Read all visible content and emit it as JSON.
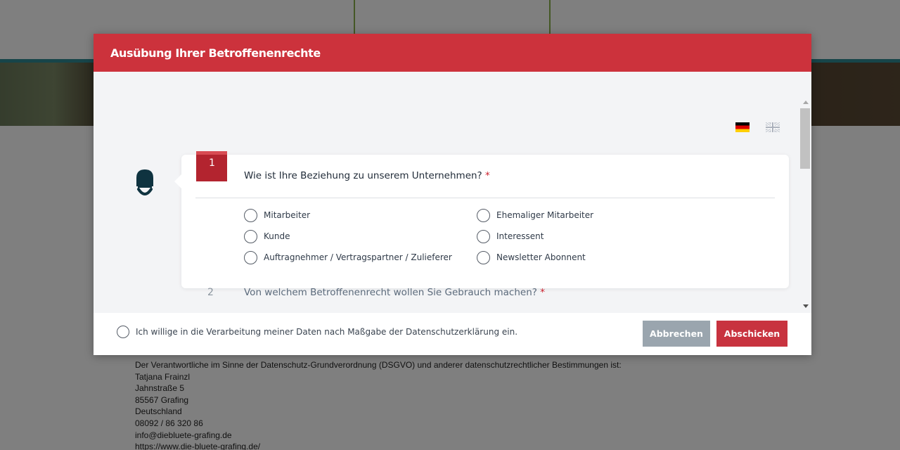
{
  "modal": {
    "title": "Ausübung Ihrer Betroffenenrechte",
    "languages": [
      "de",
      "en"
    ],
    "step1": {
      "number": "1",
      "question": "Wie ist Ihre Beziehung zu unserem Unternehmen?",
      "required_mark": "*",
      "options": [
        "Mitarbeiter",
        "Ehemaliger Mitarbeiter",
        "Kunde",
        "Interessent",
        "Auftragnehmer / Vertragspartner / Zulieferer",
        "Newsletter Abonnent"
      ]
    },
    "step2": {
      "number": "2",
      "question": "Von welchem Betroffenenrecht wollen Sie Gebrauch machen?",
      "required_mark": "*"
    },
    "footer": {
      "consent_label": "Ich willige in die Verarbeitung meiner Daten nach Maßgabe der Datenschutzerklärung ein.",
      "cancel_label": "Abbrechen",
      "submit_label": "Abschicken"
    }
  },
  "background": {
    "lines": [
      "Der Verantwortliche im Sinne der Datenschutz-Grundverordnung (DSGVO) und anderer datenschutzrechtlicher Bestimmungen ist:",
      "Tatjana Frainzl",
      "Jahnstraße 5",
      "85567 Grafing",
      "Deutschland",
      "08092 / 86 320 86",
      "info@diebluete-grafing.de",
      "https://www.die-bluete-grafing.de/"
    ]
  },
  "colors": {
    "header": "#cc323c",
    "badge": "#b3242f",
    "submit": "#c8333f",
    "cancel": "#9aa5ae"
  }
}
